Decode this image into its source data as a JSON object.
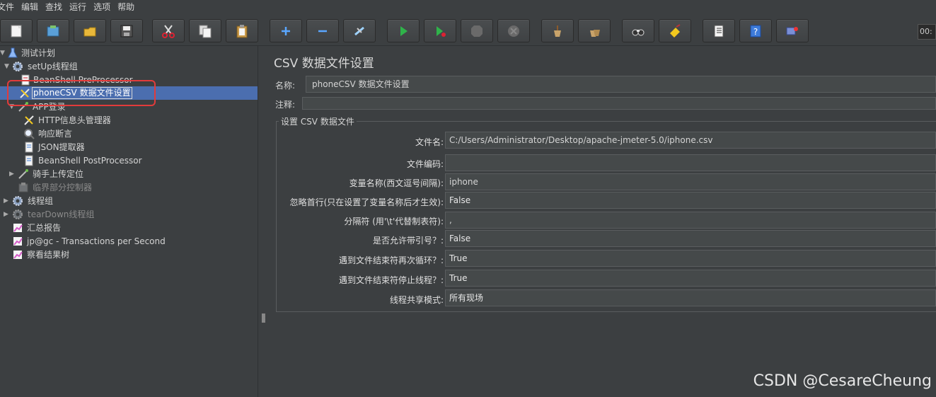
{
  "menu": [
    "文件",
    "编辑",
    "查找",
    "运行",
    "选项",
    "帮助"
  ],
  "toolbar": {
    "buttons": [
      {
        "name": "new-icon"
      },
      {
        "name": "templates-icon"
      },
      {
        "name": "open-icon"
      },
      {
        "name": "save-icon"
      },
      {
        "name": "cut-icon"
      },
      {
        "name": "copy-icon"
      },
      {
        "name": "paste-icon"
      },
      {
        "name": "expand-icon"
      },
      {
        "name": "collapse-icon"
      },
      {
        "name": "toggle-icon"
      },
      {
        "name": "start-icon"
      },
      {
        "name": "start-no-pause-icon"
      },
      {
        "name": "stop-icon"
      },
      {
        "name": "shutdown-icon"
      },
      {
        "name": "clear-icon"
      },
      {
        "name": "clear-all-icon"
      },
      {
        "name": "search-icon"
      },
      {
        "name": "reset-search-icon"
      },
      {
        "name": "function-helper-icon"
      },
      {
        "name": "help-icon"
      },
      {
        "name": "remote-icon"
      }
    ],
    "timer": "00:"
  },
  "tree": [
    {
      "label": "测试计划",
      "arrow": "▼",
      "icon": "test-plan-icon",
      "disabled": false
    },
    {
      "label": "setUp线程组",
      "arrow": "▼",
      "icon": "gear-icon",
      "disabled": false
    },
    {
      "label": "BeanShell PreProcessor",
      "arrow": "",
      "icon": "script-icon",
      "disabled": false
    },
    {
      "label": "phoneCSV 数据文件设置",
      "arrow": "",
      "icon": "config-icon",
      "disabled": false,
      "selected": true
    },
    {
      "label": "APP登录",
      "arrow": "▼",
      "icon": "sampler-icon",
      "disabled": false
    },
    {
      "label": "HTTP信息头管理器",
      "arrow": "",
      "icon": "config-icon",
      "disabled": false
    },
    {
      "label": "响应断言",
      "arrow": "",
      "icon": "assertion-icon",
      "disabled": false
    },
    {
      "label": "JSON提取器",
      "arrow": "",
      "icon": "script-icon",
      "disabled": false
    },
    {
      "label": "BeanShell PostProcessor",
      "arrow": "",
      "icon": "script-icon",
      "disabled": false
    },
    {
      "label": "骑手上传定位",
      "arrow": "▶",
      "icon": "sampler-icon",
      "disabled": false
    },
    {
      "label": "临界部分控制器",
      "arrow": "",
      "icon": "controller-icon",
      "disabled": true
    },
    {
      "label": "线程组",
      "arrow": "▶",
      "icon": "gear-icon",
      "disabled": false
    },
    {
      "label": "tearDown线程组",
      "arrow": "▶",
      "icon": "gear-icon",
      "disabled": true
    },
    {
      "label": "汇总报告",
      "arrow": "",
      "icon": "listener-icon",
      "disabled": false
    },
    {
      "label": "jp@gc - Transactions per Second",
      "arrow": "",
      "icon": "listener-icon",
      "disabled": false
    },
    {
      "label": "察看结果树",
      "arrow": "",
      "icon": "listener-icon",
      "disabled": false
    }
  ],
  "panel": {
    "title": "CSV 数据文件设置",
    "name_label": "名称:",
    "name_value": "phoneCSV 数据文件设置",
    "comment_label": "注释:",
    "comment_value": "",
    "group_title": "设置 CSV 数据文件",
    "fields": [
      {
        "label": "文件名:",
        "value": "C:/Users/Administrator/Desktop/apache-jmeter-5.0/iphone.csv",
        "combo": false
      },
      {
        "label": "文件编码:",
        "value": "",
        "combo": false
      },
      {
        "label": "变量名称(西文逗号间隔):",
        "value": "iphone",
        "combo": false
      },
      {
        "label": "忽略首行(只在设置了变量名称后才生效):",
        "value": "False",
        "combo": true
      },
      {
        "label": "分隔符 (用'\\t'代替制表符):",
        "value": ",",
        "combo": false
      },
      {
        "label": "是否允许带引号？:",
        "value": "False",
        "combo": true
      },
      {
        "label": "遇到文件结束符再次循环？:",
        "value": "True",
        "combo": true
      },
      {
        "label": "遇到文件结束符停止线程？:",
        "value": "True",
        "combo": true
      },
      {
        "label": "线程共享模式:",
        "value": "所有现场",
        "combo": true
      }
    ]
  },
  "watermark": "CSDN @CesareCheung",
  "colors": {
    "background": "#3c3f41",
    "selection": "#4b6eaf",
    "callout": "#e23b3b"
  }
}
